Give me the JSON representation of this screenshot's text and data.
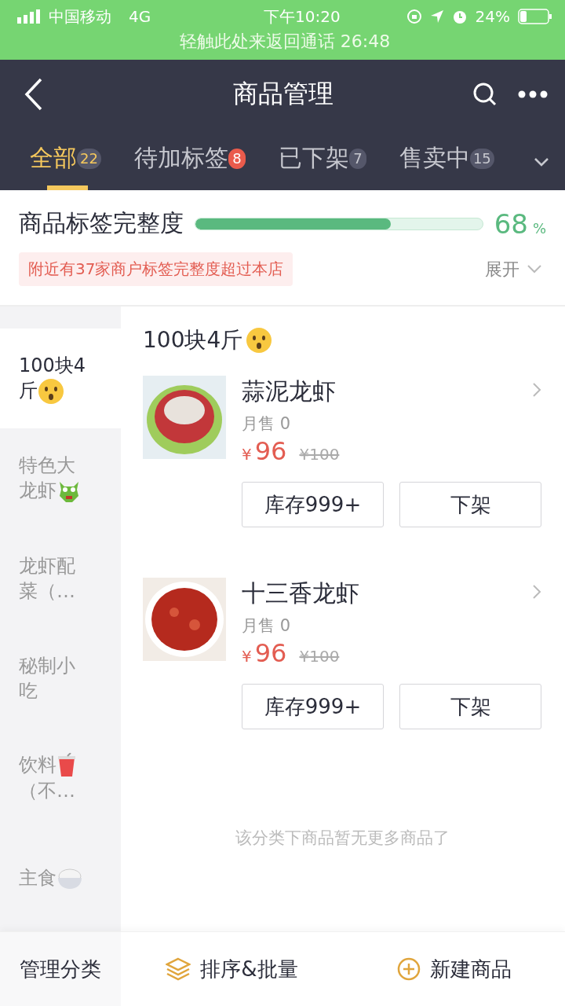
{
  "status_bar": {
    "carrier": "中国移动",
    "network": "4G",
    "time": "下午10:20",
    "battery_text": "24%",
    "call_banner": "轻触此处来返回通话 26:48"
  },
  "header": {
    "title": "商品管理"
  },
  "tabs": [
    {
      "label": "全部",
      "count": "22",
      "selected": true,
      "alert": false
    },
    {
      "label": "待加标签",
      "count": "8",
      "selected": false,
      "alert": true
    },
    {
      "label": "已下架",
      "count": "7",
      "selected": false,
      "alert": false
    },
    {
      "label": "售卖中",
      "count": "15",
      "selected": false,
      "alert": false
    }
  ],
  "completeness": {
    "title": "商品标签完整度",
    "level": 0.68,
    "value": "68",
    "unit": "%",
    "notice": "附近有37家商户标签完整度超过本店",
    "expand": "展开"
  },
  "sidebar": {
    "items": [
      {
        "label": "100块4斤",
        "kind": "face",
        "selected": true
      },
      {
        "label": "特色大龙虾",
        "kind": "dragon",
        "selected": false
      },
      {
        "label": "龙虾配菜（…",
        "kind": "plain",
        "selected": false
      },
      {
        "label": "秘制小吃",
        "kind": "plain",
        "selected": false
      },
      {
        "label": "饮料",
        "kind": "cup",
        "suffix": "（不…",
        "selected": false
      },
      {
        "label": "主食",
        "kind": "rice",
        "selected": false
      }
    ]
  },
  "category": {
    "title": "100块4斤",
    "kind": "face"
  },
  "products": [
    {
      "name": "蒜泥龙虾",
      "kind": "bowl",
      "sales": "月售 0",
      "currency": "¥",
      "price": "96",
      "old_price": "¥100",
      "stock_button": "库存999+",
      "off_button": "下架"
    },
    {
      "name": "十三香龙虾",
      "kind": "plate",
      "sales": "月售 0",
      "currency": "¥",
      "price": "96",
      "old_price": "¥100",
      "stock_button": "库存999+",
      "off_button": "下架"
    }
  ],
  "empty_note": "该分类下商品暂无更多商品了",
  "bottom_bar": {
    "manage": "管理分类",
    "sort": "排序&批量",
    "create": "新建商品"
  }
}
